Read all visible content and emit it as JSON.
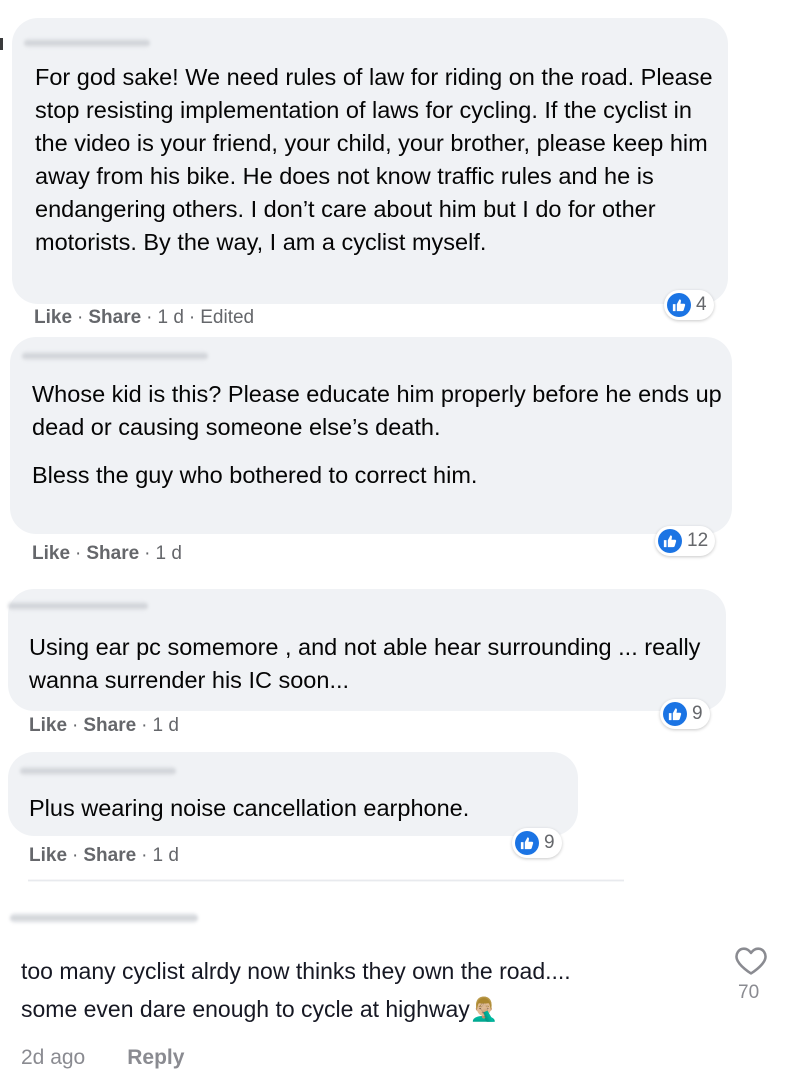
{
  "comments": [
    {
      "text": "For god sake! We need rules of law for riding on the road. Please stop resisting implementation of laws for cycling. If the cyclist in the video is your friend, your child, your brother, please keep him away from his bike. He does not know traffic rules and he is endangering others. I don’t care about him but I do for other motorists. By the way, I am a cyclist myself.",
      "like": "Like",
      "share": "Share",
      "time": "1 d",
      "edited": "Edited",
      "reactions": "4"
    },
    {
      "text_1": "Whose kid is this? Please educate him properly before he ends up dead or causing someone else’s death.",
      "text_2": "Bless the guy who bothered to correct him.",
      "like": "Like",
      "share": "Share",
      "time": "1 d",
      "reactions": "12"
    },
    {
      "text": "Using ear pc somemore , and not able hear surrounding ... really wanna surrender his IC soon...",
      "like": "Like",
      "share": "Share",
      "time": "1 d",
      "reactions": "9"
    },
    {
      "text": "Plus wearing noise cancellation earphone.",
      "like": "Like",
      "share": "Share",
      "time": "1 d",
      "reactions": "9"
    }
  ],
  "tiktok_comment": {
    "line_1": "too many cyclist alrdy now thinks they own the road....",
    "line_2": "some even dare enough to cycle at highway",
    "emoji": "🤦🏼‍♂️",
    "time": "2d ago",
    "reply": "Reply",
    "likes": "70"
  },
  "icons": {
    "reaction": "like-thumb-icon",
    "heart": "heart-outline-icon"
  },
  "colors": {
    "bubble": "#f0f2f5",
    "like_blue": "#1b74e4",
    "meta_gray": "#65676b"
  }
}
